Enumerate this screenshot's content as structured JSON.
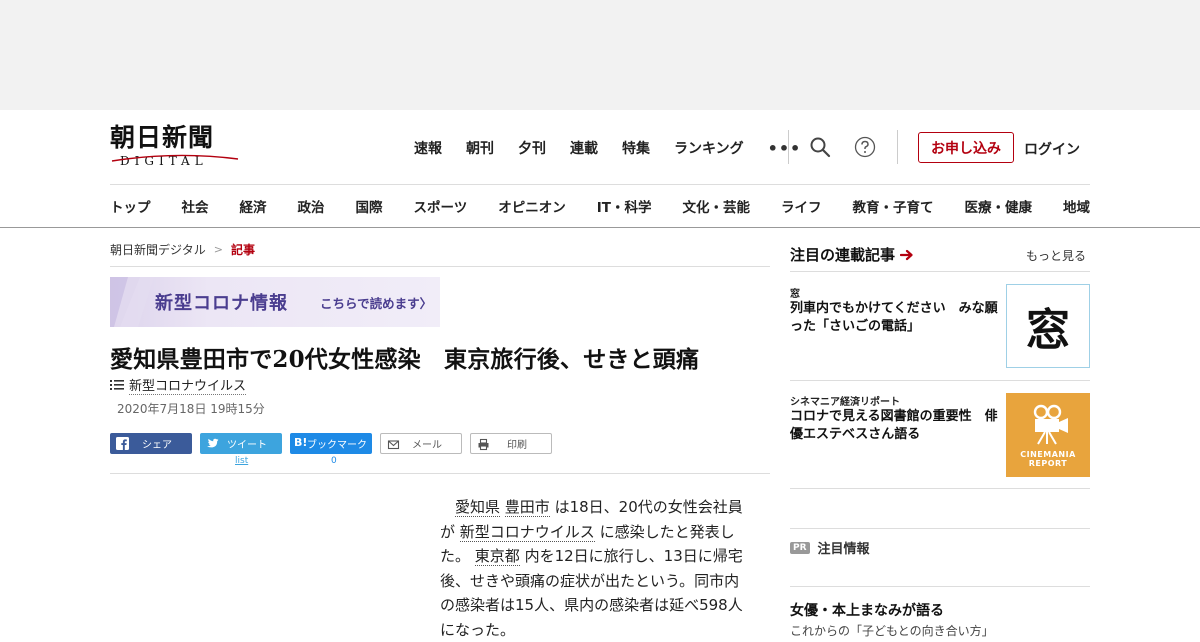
{
  "logo": {
    "jp": "朝日新聞",
    "en": "DIGITAL"
  },
  "topnav": [
    "速報",
    "朝刊",
    "夕刊",
    "連載",
    "特集",
    "ランキング"
  ],
  "header_buttons": {
    "apply": "お申し込み",
    "login": "ログイン",
    "more": "•••"
  },
  "subnav": [
    "トップ",
    "社会",
    "経済",
    "政治",
    "国際",
    "スポーツ",
    "オピニオン",
    "IT・科学",
    "文化・芸能",
    "ライフ",
    "教育・子育て",
    "医療・健康",
    "地域"
  ],
  "breadcrumb": {
    "home": "朝日新聞デジタル",
    "sep": ">",
    "current": "記事"
  },
  "banner": {
    "title": "新型コロナ情報",
    "cta": "こちらで読めます〉"
  },
  "article": {
    "headline": "愛知県豊田市で20代女性感染　東京旅行後、せきと頭痛",
    "tag": "新型コロナウイルス",
    "date": "2020年7月18日 19時15分",
    "share": {
      "facebook": "シェア",
      "twitter": "ツイート",
      "hatena": "ブックマーク",
      "hatena_logo": "B!",
      "mail": "メール",
      "print": "印刷",
      "twitter_count": "list",
      "hatena_count": "0"
    },
    "body": {
      "p1": "愛知県",
      "p2": "豊田市",
      "p3": "は18日、20代の女性会社員が",
      "p4": "新型コロナウイルス",
      "p5": "に感染したと発表した。",
      "p6": "東京都",
      "p7": "内を12日に旅行し、13日に帰宅後、せきや頭痛の症状が出たという。同市内の感染者は15人、県内の感染者は延べ598人になった。"
    }
  },
  "sidebar": {
    "heading": "注目の連載記事",
    "more": "もっと見る",
    "items": [
      {
        "kicker": "窓",
        "title": "列車内でもかけてください　みな願った「さいごの電話」",
        "thumb": "窓"
      },
      {
        "kicker": "シネマニア経済リポート",
        "title": "コロナで見える図書館の重要性　俳優エステベスさん語る",
        "thumb_line1": "CINEMANIA",
        "thumb_line2": "REPORT"
      }
    ],
    "pr_badge": "PR",
    "pr_label": "注目情報",
    "bottom_title": "女優・本上まなみが語る",
    "bottom_sub": "これからの「子どもとの向き合い方」"
  },
  "colors": {
    "accent_red": "#b3000f",
    "facebook": "#3b5b9a",
    "twitter": "#3da4de",
    "hatena": "#1e8ae6",
    "corona_purple": "#4a3d8f",
    "cinemania_orange": "#e8a43d"
  }
}
